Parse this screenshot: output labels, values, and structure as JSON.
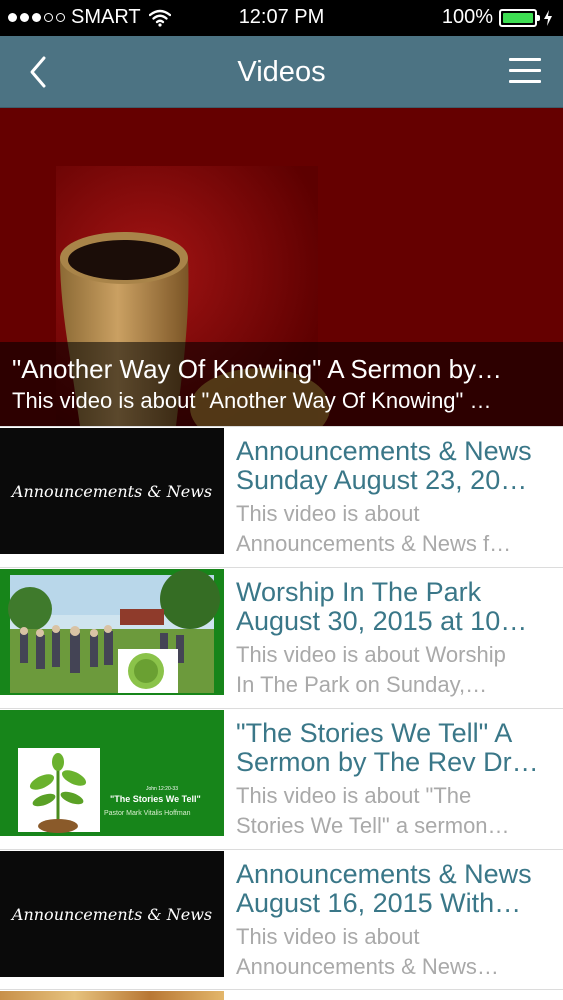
{
  "status_bar": {
    "carrier": "SMART",
    "time": "12:07 PM",
    "battery": "100%",
    "battery_level": 1.0,
    "signal_bars": 3,
    "signal_total": 5,
    "icons": [
      "signal-dots-icon",
      "wifi-icon",
      "battery-icon",
      "charging-bolt-icon"
    ]
  },
  "nav": {
    "title": "Videos",
    "back_icon": "chevron-left-icon",
    "menu_icon": "hamburger-menu-icon"
  },
  "featured": {
    "title": "\"Another Way Of Knowing\" A Sermon by…",
    "description": "This video is about \"Another Way Of Knowing\" …"
  },
  "videos": [
    {
      "title_line1": "Announcements & News",
      "title_line2": "Sunday August 23, 20…",
      "desc_line1": "This video is about",
      "desc_line2": "Announcements & News f…",
      "thumb_text": "Announcements & News"
    },
    {
      "title_line1": "Worship In The Park",
      "title_line2": "August 30, 2015 at 10…",
      "desc_line1": "This video is about Worship",
      "desc_line2": "In The Park on Sunday,…"
    },
    {
      "title_line1": "\"The Stories We Tell\" A",
      "title_line2": "Sermon by The Rev Dr…",
      "desc_line1": "This video is about \"The",
      "desc_line2": "Stories We Tell\" a sermon…",
      "thumb_ref": "John 12:20-33",
      "thumb_title": "\"The Stories We Tell\"",
      "thumb_author": "Pastor Mark Vitalis Hoffman"
    },
    {
      "title_line1": "Announcements & News",
      "title_line2": "August 16, 2015 With…",
      "desc_line1": "This video is about",
      "desc_line2": "Announcements & News…",
      "thumb_text": "Announcements & News"
    }
  ],
  "colors": {
    "nav_bg": "#4c7383",
    "title_teal": "#3a7788",
    "desc_gray": "#a9a9a9",
    "featured_bg": "#6a0000",
    "battery_green": "#3ddc52",
    "thumb_green": "#17851a"
  }
}
